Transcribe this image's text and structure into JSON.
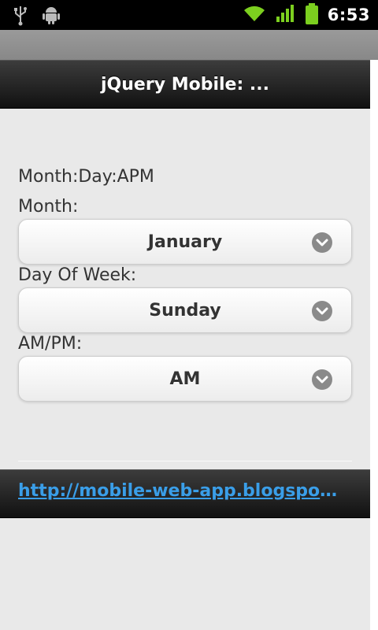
{
  "status_bar": {
    "time": "6:53",
    "icons": [
      "usb-icon",
      "android-debug-icon",
      "wifi-icon",
      "signal-icon",
      "battery-icon"
    ]
  },
  "header": {
    "title": "jQuery Mobile: ..."
  },
  "content": {
    "heading": "Month:Day:APM",
    "fields": [
      {
        "label": "Month:",
        "selected": "January"
      },
      {
        "label": "Day Of Week:",
        "selected": "Sunday"
      },
      {
        "label": "AM/PM:",
        "selected": "AM"
      }
    ]
  },
  "footer": {
    "link_text": "http://mobile-web-app.blogspot.c..."
  },
  "colors": {
    "header_bg": "#1f1f1f",
    "page_bg": "#e9e9e9",
    "link": "#3a9ee8",
    "battery": "#7ccf1f"
  }
}
